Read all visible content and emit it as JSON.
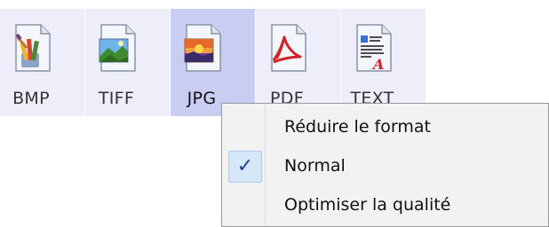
{
  "toolbar": {
    "buttons": [
      {
        "label": "BMP",
        "icon": "bmp-file-icon",
        "selected": false
      },
      {
        "label": "TIFF",
        "icon": "tiff-file-icon",
        "selected": false
      },
      {
        "label": "JPG",
        "icon": "jpg-file-icon",
        "selected": true
      },
      {
        "label": "PDF",
        "icon": "pdf-file-icon",
        "selected": false
      },
      {
        "label": "TEXT",
        "icon": "text-file-icon",
        "selected": false
      }
    ]
  },
  "context_menu": {
    "items": [
      {
        "label": "Réduire le format",
        "checked": false
      },
      {
        "label": "Normal",
        "checked": true,
        "check_glyph": "✓"
      },
      {
        "label": "Optimiser la qualité",
        "checked": false
      }
    ]
  },
  "colors": {
    "button_bg": "#eeeefb",
    "button_selected_bg": "#c9cdf2",
    "menu_bg": "#f2f2f2",
    "check_highlight": "#d6e7fa",
    "check_color": "#1b3f8c"
  }
}
